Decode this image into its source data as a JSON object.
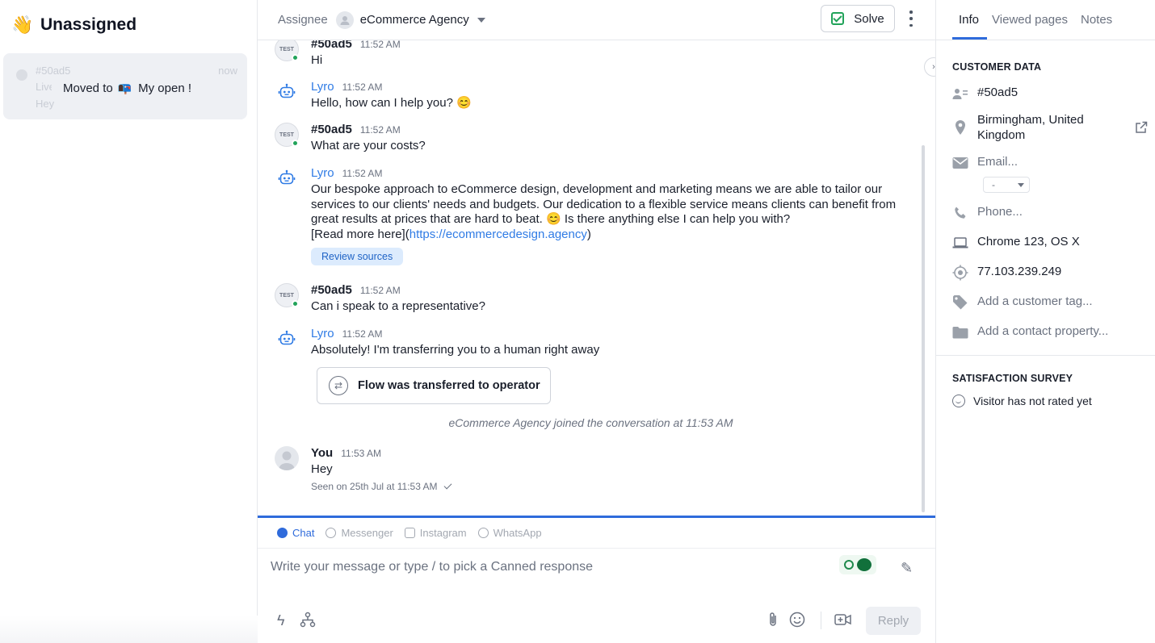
{
  "inbox": {
    "title": "Unassigned",
    "title_icon": "waving-hand",
    "conversation": {
      "visitor_id": "#50ad5",
      "time": "now",
      "status": "Live",
      "last_message": "Hey"
    },
    "toast": {
      "prefix": "Moved to",
      "icon": "mailbox",
      "folder": "My open !"
    }
  },
  "header": {
    "assignee_label": "Assignee",
    "assignee_name": "eCommerce Agency",
    "solve_label": "Solve"
  },
  "messages": [
    {
      "author": "#50ad5",
      "time": "11:52 AM",
      "text": "Hi",
      "avatar": "TEST"
    },
    {
      "author": "Lyro",
      "time": "11:52 AM",
      "text": "Hello, how can I help you? 😊"
    },
    {
      "author": "#50ad5",
      "time": "11:52 AM",
      "text": "What are your costs?",
      "avatar": "TEST"
    },
    {
      "author": "Lyro",
      "time": "11:52 AM",
      "text": "Our bespoke approach to eCommerce design, development and marketing means we are able to tailor our services to our clients' needs and budgets. Our dedication to a flexible service means clients can benefit from great results at prices that are hard to beat. 😊 Is there anything else I can help you with?",
      "link_prefix": "[Read more here](",
      "link_text": "https://ecommercedesign.agency",
      "link_suffix": ")",
      "review_label": "Review sources"
    },
    {
      "author": "#50ad5",
      "time": "11:52 AM",
      "text": "Can i speak to a representative?",
      "avatar": "TEST"
    },
    {
      "author": "Lyro",
      "time": "11:52 AM",
      "text": "Absolutely! I'm transferring you to a human right away"
    },
    {
      "author": "You",
      "time": "11:53 AM",
      "text": "Hey"
    }
  ],
  "transfer_event": "Flow was transferred to operator",
  "joined_event": "eCommerce Agency joined the conversation at 11:53 AM",
  "seen_status": "Seen on 25th Jul at 11:53 AM",
  "channels": [
    {
      "label": "Chat",
      "active": true
    },
    {
      "label": "Messenger",
      "active": false
    },
    {
      "label": "Instagram",
      "active": false
    },
    {
      "label": "WhatsApp",
      "active": false
    }
  ],
  "composer": {
    "placeholder": "Write your message or type / to pick a Canned response",
    "reply_label": "Reply"
  },
  "sidebar": {
    "tabs": [
      "Info",
      "Viewed pages",
      "Notes"
    ],
    "active_tab": "Info",
    "customer_data_title": "CUSTOMER DATA",
    "visitor_id": "#50ad5",
    "location": "Birmingham, United Kingdom",
    "email_placeholder": "Email...",
    "email_select_value": "-",
    "phone_placeholder": "Phone...",
    "browser": "Chrome 123, OS X",
    "ip": "77.103.239.249",
    "add_tag": "Add a customer tag...",
    "add_property": "Add a contact property...",
    "survey_title": "SATISFACTION SURVEY",
    "survey_status": "Visitor has not rated yet"
  },
  "colors": {
    "accent": "#2f6bdb",
    "link": "#2f7be5",
    "online": "#22a35a"
  }
}
